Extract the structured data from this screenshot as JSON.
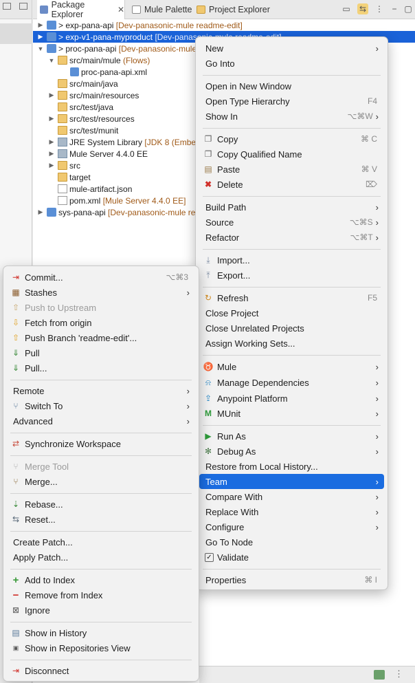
{
  "explorer": {
    "tabs": [
      {
        "label": "Package Explorer",
        "close": "✕",
        "icon_color": "#6b8cc7"
      },
      {
        "label": "Mule Palette",
        "icon_color": "#8a8a8a"
      },
      {
        "label": "Project Explorer",
        "icon_color": "#c89a3a"
      }
    ],
    "rows": [
      {
        "name": "exp-pana-api",
        "ann": "[Dev-panasonic-mule readme-edit]",
        "prefix": ">"
      },
      {
        "name": "exp-v1-pana-myproduct",
        "ann": "[Dev-panasonic-mule readme-edit]",
        "prefix": ">"
      },
      {
        "name": "proc-pana-api",
        "ann": "[Dev-panasonic-mule",
        "prefix": ">"
      },
      {
        "name": "src/main/mule",
        "ann": "(Flows)"
      },
      {
        "name": "proc-pana-api.xml"
      },
      {
        "name": "src/main/java"
      },
      {
        "name": "src/main/resources"
      },
      {
        "name": "src/test/java"
      },
      {
        "name": "src/test/resources"
      },
      {
        "name": "src/test/munit"
      },
      {
        "name": "JRE System Library",
        "ann": "[JDK 8 (Embed"
      },
      {
        "name": "Mule Server 4.4.0 EE"
      },
      {
        "name": "src"
      },
      {
        "name": "target"
      },
      {
        "name": "mule-artifact.json"
      },
      {
        "name": "pom.xml",
        "ann": "[Mule Server 4.4.0 EE]"
      },
      {
        "name": "sys-pana-api",
        "ann": "[Dev-panasonic-mule re"
      }
    ]
  },
  "context_menu": {
    "items": [
      {
        "label": "New",
        "arrow": "›"
      },
      {
        "label": "Go Into"
      },
      {
        "label": "Open in New Window"
      },
      {
        "label": "Open Type Hierarchy",
        "shortcut": "F4"
      },
      {
        "label": "Show In",
        "shortcut": "⌥⌘W",
        "arrow": "›"
      },
      {
        "label": "Copy",
        "shortcut": "⌘ C"
      },
      {
        "label": "Copy Qualified Name"
      },
      {
        "label": "Paste",
        "shortcut": "⌘ V"
      },
      {
        "label": "Delete",
        "shortcut": "⌦"
      },
      {
        "label": "Build Path",
        "arrow": "›"
      },
      {
        "label": "Source",
        "shortcut": "⌥⌘S",
        "arrow": "›"
      },
      {
        "label": "Refactor",
        "shortcut": "⌥⌘T",
        "arrow": "›"
      },
      {
        "label": "Import..."
      },
      {
        "label": "Export..."
      },
      {
        "label": "Refresh",
        "shortcut": "F5"
      },
      {
        "label": "Close Project"
      },
      {
        "label": "Close Unrelated Projects"
      },
      {
        "label": "Assign Working Sets..."
      },
      {
        "label": "Mule",
        "arrow": "›"
      },
      {
        "label": "Manage Dependencies",
        "arrow": "›"
      },
      {
        "label": "Anypoint Platform",
        "arrow": "›"
      },
      {
        "label": "MUnit",
        "arrow": "›"
      },
      {
        "label": "Run As",
        "arrow": "›"
      },
      {
        "label": "Debug As",
        "arrow": "›"
      },
      {
        "label": "Restore from Local History..."
      },
      {
        "label": "Team",
        "arrow": "›"
      },
      {
        "label": "Compare With",
        "arrow": "›"
      },
      {
        "label": "Replace With",
        "arrow": "›"
      },
      {
        "label": "Configure",
        "arrow": "›"
      },
      {
        "label": "Go To Node"
      },
      {
        "label": "Validate"
      },
      {
        "label": "Properties",
        "shortcut": "⌘ I"
      }
    ]
  },
  "team_menu": {
    "items": [
      {
        "label": "Commit...",
        "shortcut": "⌥⌘3"
      },
      {
        "label": "Stashes",
        "arrow": "›"
      },
      {
        "label": "Push to Upstream"
      },
      {
        "label": "Fetch from origin"
      },
      {
        "label": "Push Branch 'readme-edit'..."
      },
      {
        "label": "Pull"
      },
      {
        "label": "Pull..."
      },
      {
        "label": "Remote",
        "arrow": "›"
      },
      {
        "label": "Switch To",
        "arrow": "›"
      },
      {
        "label": "Advanced",
        "arrow": "›"
      },
      {
        "label": "Synchronize Workspace"
      },
      {
        "label": "Merge Tool"
      },
      {
        "label": "Merge..."
      },
      {
        "label": "Rebase..."
      },
      {
        "label": "Reset..."
      },
      {
        "label": "Create Patch..."
      },
      {
        "label": "Apply Patch..."
      },
      {
        "label": "Add to Index"
      },
      {
        "label": "Remove from Index"
      },
      {
        "label": "Ignore"
      },
      {
        "label": "Show in History"
      },
      {
        "label": "Show in Repositories View"
      },
      {
        "label": "Disconnect"
      }
    ]
  },
  "colors": {
    "selection": "#1a62d8",
    "menu_highlight": "#1a6ce0",
    "annotation": "#a05a18"
  }
}
